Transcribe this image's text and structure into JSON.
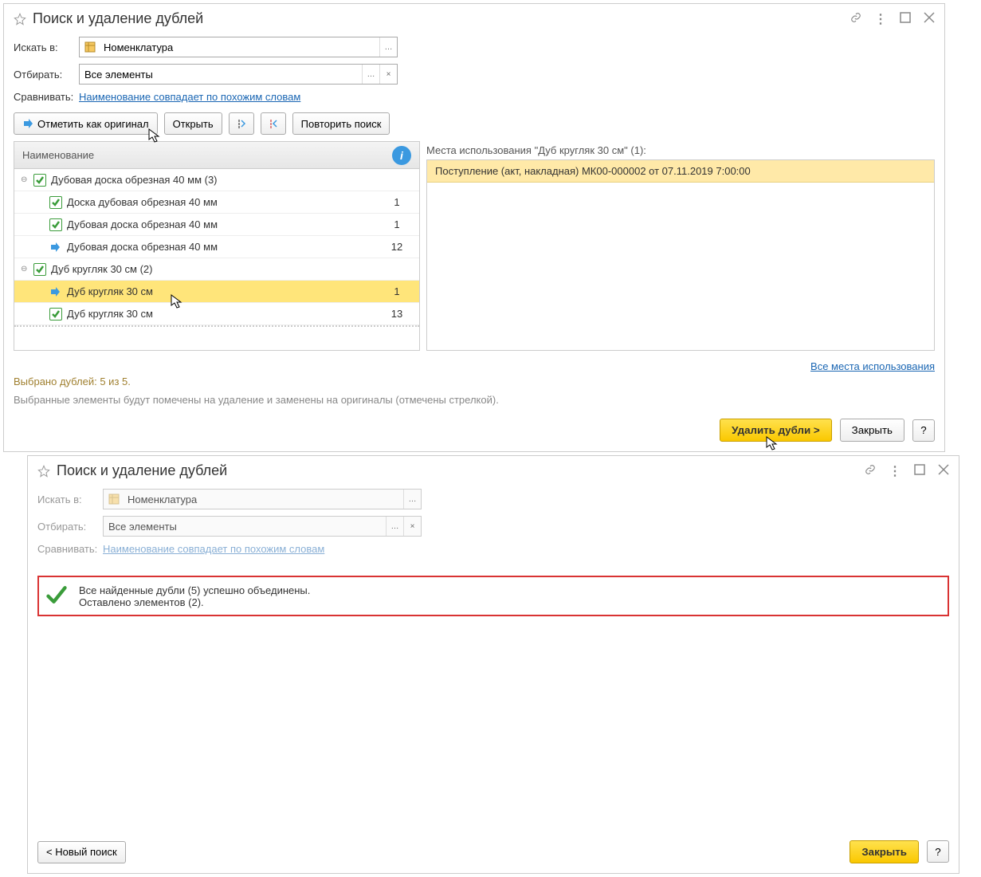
{
  "win1": {
    "title": "Поиск и удаление дублей",
    "search_in_label": "Искать в:",
    "search_in_value": "Номенклатура",
    "filter_label": "Отбирать:",
    "filter_value": "Все элементы",
    "compare_label": "Сравнивать:",
    "compare_link": "Наименование совпадает по похожим словам",
    "toolbar": {
      "mark_original": "Отметить как оригинал",
      "open": "Открыть",
      "repeat": "Повторить поиск"
    },
    "table": {
      "header_name": "Наименование",
      "groups": [
        {
          "label": "Дубовая доска обрезная 40 мм (3)",
          "children": [
            {
              "type": "check",
              "label": "Доска дубовая  обрезная 40  мм",
              "count": "1"
            },
            {
              "type": "check",
              "label": "Дубовая доска обрезная 40  мм",
              "count": "1"
            },
            {
              "type": "arrow",
              "label": "Дубовая доска обрезная 40 мм",
              "count": "12"
            }
          ]
        },
        {
          "label": "Дуб кругляк 30  см (2)",
          "children": [
            {
              "type": "arrow",
              "label": "Дуб кругляк 30  см",
              "count": "1",
              "selected": true
            },
            {
              "type": "check",
              "label": "Дуб кругляк 30 см",
              "count": "13"
            }
          ]
        }
      ]
    },
    "usage": {
      "header": "Места использования \"Дуб кругляк 30  см\" (1):",
      "items": [
        "Поступление (акт, накладная) МК00-000002 от 07.11.2019 7:00:00"
      ],
      "all_link": "Все места использования"
    },
    "status1": "Выбрано дублей: 5 из 5.",
    "status2": "Выбранные элементы будут помечены на удаление и заменены на оригиналы (отмечены стрелкой).",
    "buttons": {
      "delete": "Удалить дубли >",
      "close": "Закрыть",
      "help": "?"
    }
  },
  "win2": {
    "title": "Поиск и удаление дублей",
    "search_in_label": "Искать в:",
    "search_in_value": "Номенклатура",
    "filter_label": "Отбирать:",
    "filter_value": "Все элементы",
    "compare_label": "Сравнивать:",
    "compare_link": "Наименование совпадает по похожим словам",
    "success_line1": "Все найденные дубли (5) успешно объединены.",
    "success_line2": "Оставлено элементов (2).",
    "buttons": {
      "new_search": "< Новый поиск",
      "close": "Закрыть",
      "help": "?"
    }
  }
}
